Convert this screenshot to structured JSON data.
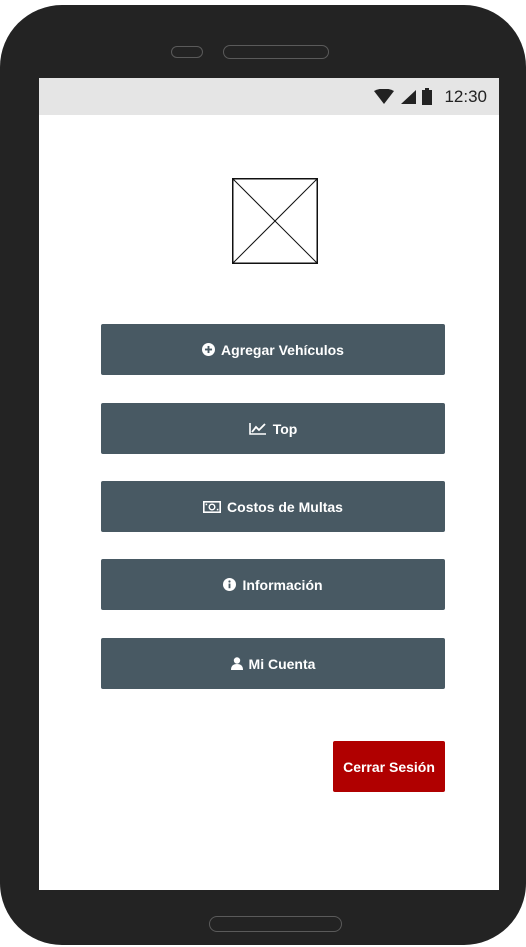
{
  "status_bar": {
    "time": "12:30",
    "icons": [
      "wifi-icon",
      "signal-icon",
      "battery-icon"
    ]
  },
  "logo": {
    "icon": "image-placeholder-icon"
  },
  "menu": {
    "agregar": {
      "label": "Agregar Vehículos",
      "icon": "plus-circle-icon"
    },
    "top": {
      "label": "Top",
      "icon": "line-chart-icon"
    },
    "costos": {
      "label": "Costos de Multas",
      "icon": "money-bill-icon"
    },
    "info": {
      "label": "Información",
      "icon": "info-circle-icon"
    },
    "cuenta": {
      "label": "Mi Cuenta",
      "icon": "user-icon"
    }
  },
  "logout": {
    "label": "Cerrar Sesión"
  },
  "colors": {
    "button_bg": "#485963",
    "logout_bg": "#b00000",
    "device_frame": "#232323",
    "status_bar_bg": "#e5e5e5"
  }
}
